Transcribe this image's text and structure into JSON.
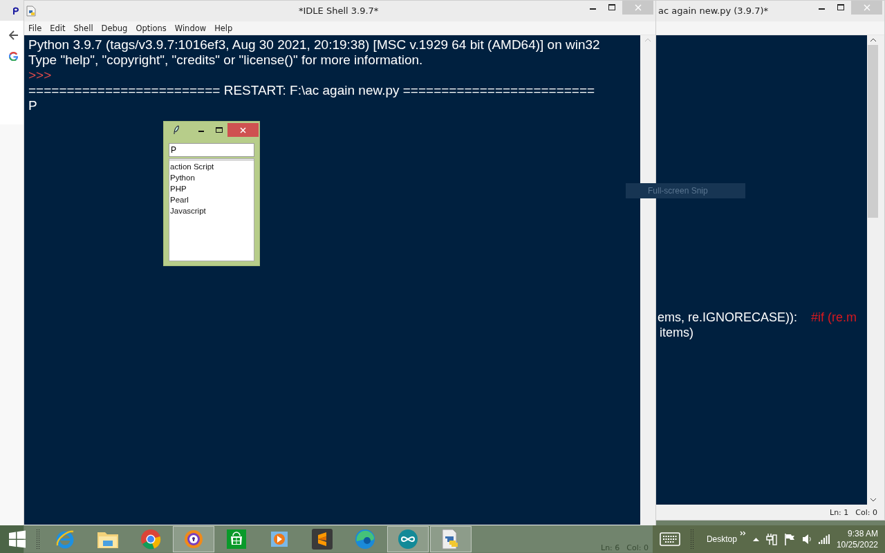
{
  "shell_window": {
    "title": "*IDLE Shell 3.9.7*",
    "menu": [
      "File",
      "Edit",
      "Shell",
      "Debug",
      "Options",
      "Window",
      "Help"
    ],
    "lines": [
      {
        "kind": "output",
        "text": "Python 3.9.7 (tags/v3.9.7:1016ef3, Aug 30 2021, 20:19:38) [MSC v.1929 64 bit (AMD64)] on win32"
      },
      {
        "kind": "output",
        "text": "Type \"help\", \"copyright\", \"credits\" or \"license()\" for more information."
      },
      {
        "kind": "prompt",
        "text": ">>>"
      },
      {
        "kind": "output",
        "text": "========================= RESTART: F:\\ac again new.py ========================="
      },
      {
        "kind": "output",
        "text": "P"
      }
    ],
    "status": {
      "line": "Ln: 6",
      "col": "Col: 0"
    }
  },
  "dialog": {
    "entry": {
      "value": "P"
    },
    "list_items": [
      "action Script",
      "Python",
      "PHP",
      "Pearl",
      "Javascript"
    ]
  },
  "editor_window": {
    "title": "ac again new.py (3.9.7)*",
    "lines": [
      {
        "segments": [
          {
            "kind": "code",
            "text": "ems, re.IGNORECASE)):"
          },
          {
            "kind": "comment",
            "text": "#if (re.m"
          }
        ]
      },
      {
        "segments": [
          {
            "kind": "code",
            "text": "items)"
          }
        ]
      }
    ],
    "status": {
      "line": "Ln: 1",
      "col": "Col: 0"
    }
  },
  "tooltip": {
    "text": "Full-screen Snip"
  },
  "taskbar": {
    "apps": [
      {
        "kind": "ie",
        "selected": false
      },
      {
        "kind": "folder",
        "selected": false
      },
      {
        "kind": "chrome",
        "selected": false
      },
      {
        "kind": "shield",
        "selected": true
      },
      {
        "kind": "store",
        "selected": false
      },
      {
        "kind": "player",
        "selected": false
      },
      {
        "kind": "sublime",
        "selected": false
      },
      {
        "kind": "edge",
        "selected": false
      },
      {
        "kind": "infinity",
        "selected": true
      },
      {
        "kind": "python",
        "selected": true
      }
    ],
    "toolbar_label": "Desktop",
    "time": "9:38 AM",
    "date": "10/25/2022"
  }
}
